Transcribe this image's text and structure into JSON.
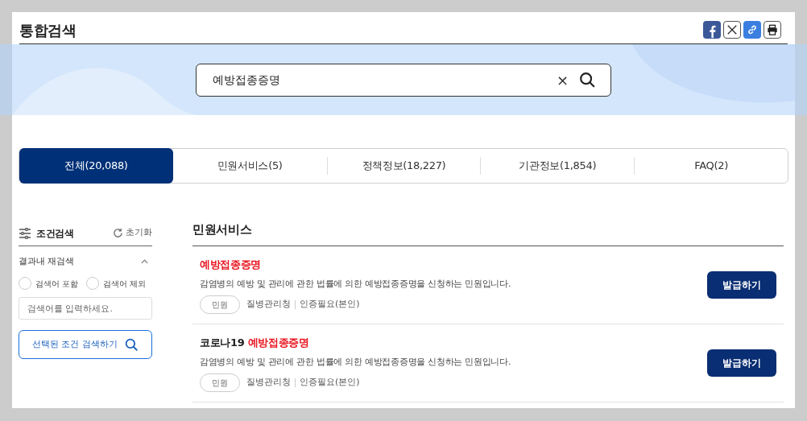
{
  "header": {
    "title": "통합검색"
  },
  "search": {
    "value": "예방접종증명",
    "clear": "×"
  },
  "tabs": [
    {
      "label": "전체(20,088)",
      "selected": true
    },
    {
      "label": "민원서비스(5)",
      "selected": false
    },
    {
      "label": "정책정보(18,227)",
      "selected": false
    },
    {
      "label": "기관정보(1,854)",
      "selected": false
    },
    {
      "label": "FAQ(2)",
      "selected": false
    }
  ],
  "filter": {
    "title": "조건검색",
    "reset": "초기화",
    "section": "결과내 재검색",
    "expanded": true,
    "options": [
      {
        "label": "검색어 포함",
        "selected": false
      },
      {
        "label": "검색어 제외",
        "selected": false
      }
    ],
    "placeholder": "검색어를 입력하세요.",
    "submit": "선택된 조건 검색하기"
  },
  "results": {
    "heading": "민원서비스",
    "items": [
      {
        "title_parts": [
          {
            "text": "예방접종증명",
            "highlight": true
          }
        ],
        "description": "감염병의 예방 및 관리에 관한 법률에 의한 예방접종증명을 신청하는 민원입니다.",
        "tag": "민원",
        "agency": "질병관리청",
        "auth": "인증필요(본인)",
        "action": "발급하기"
      },
      {
        "title_parts": [
          {
            "text": "코로나19 ",
            "highlight": false
          },
          {
            "text": "예방접종증명",
            "highlight": true
          }
        ],
        "description": "감염병의 예방 및 관리에 관한 법률에 의한 예방접종증명을 신청하는 민원입니다.",
        "tag": "민원",
        "agency": "질병관리청",
        "auth": "인증필요(본인)",
        "action": "발급하기"
      }
    ]
  }
}
